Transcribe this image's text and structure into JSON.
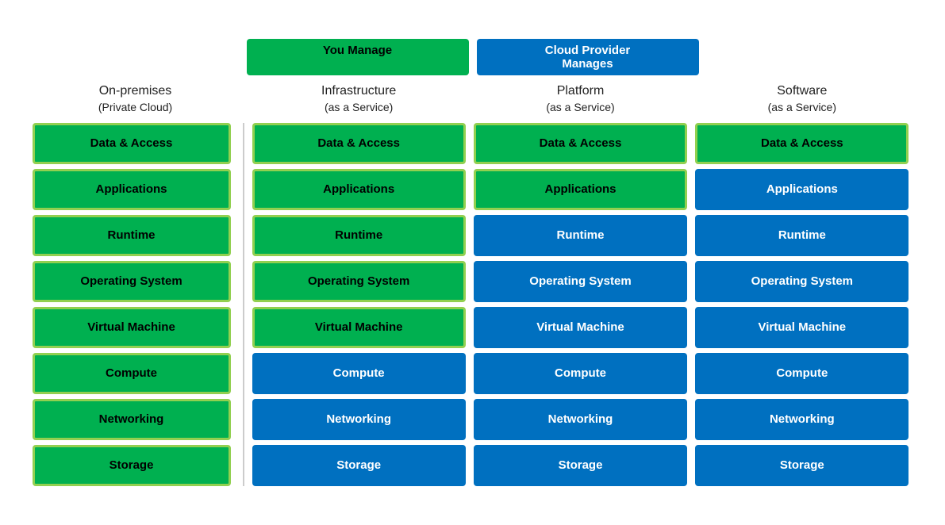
{
  "topLabels": [
    {
      "id": "you-manage",
      "text": "You Manage",
      "style": "green"
    },
    {
      "id": "cloud-provider",
      "text": "Cloud Provider Manages",
      "style": "blue"
    }
  ],
  "columns": [
    {
      "id": "on-premises",
      "header": "On-premises\n(Private Cloud)",
      "cells": [
        {
          "label": "Data & Access",
          "style": "green"
        },
        {
          "label": "Applications",
          "style": "green"
        },
        {
          "label": "Runtime",
          "style": "green"
        },
        {
          "label": "Operating System",
          "style": "green"
        },
        {
          "label": "Virtual Machine",
          "style": "green"
        },
        {
          "label": "Compute",
          "style": "green"
        },
        {
          "label": "Networking",
          "style": "green"
        },
        {
          "label": "Storage",
          "style": "green"
        }
      ]
    },
    {
      "id": "iaas",
      "header": "Infrastructure\n(as a Service)",
      "cells": [
        {
          "label": "Data & Access",
          "style": "green"
        },
        {
          "label": "Applications",
          "style": "green"
        },
        {
          "label": "Runtime",
          "style": "green"
        },
        {
          "label": "Operating System",
          "style": "green"
        },
        {
          "label": "Virtual Machine",
          "style": "green"
        },
        {
          "label": "Compute",
          "style": "blue"
        },
        {
          "label": "Networking",
          "style": "blue"
        },
        {
          "label": "Storage",
          "style": "blue"
        }
      ]
    },
    {
      "id": "paas",
      "header": "Platform\n(as a Service)",
      "cells": [
        {
          "label": "Data & Access",
          "style": "green"
        },
        {
          "label": "Applications",
          "style": "green"
        },
        {
          "label": "Runtime",
          "style": "blue"
        },
        {
          "label": "Operating System",
          "style": "blue"
        },
        {
          "label": "Virtual Machine",
          "style": "blue"
        },
        {
          "label": "Compute",
          "style": "blue"
        },
        {
          "label": "Networking",
          "style": "blue"
        },
        {
          "label": "Storage",
          "style": "blue"
        }
      ]
    },
    {
      "id": "saas",
      "header": "Software\n(as a Service)",
      "cells": [
        {
          "label": "Data & Access",
          "style": "green"
        },
        {
          "label": "Applications",
          "style": "blue"
        },
        {
          "label": "Runtime",
          "style": "blue"
        },
        {
          "label": "Operating System",
          "style": "blue"
        },
        {
          "label": "Virtual Machine",
          "style": "blue"
        },
        {
          "label": "Compute",
          "style": "blue"
        },
        {
          "label": "Networking",
          "style": "blue"
        },
        {
          "label": "Storage",
          "style": "blue"
        }
      ]
    }
  ]
}
